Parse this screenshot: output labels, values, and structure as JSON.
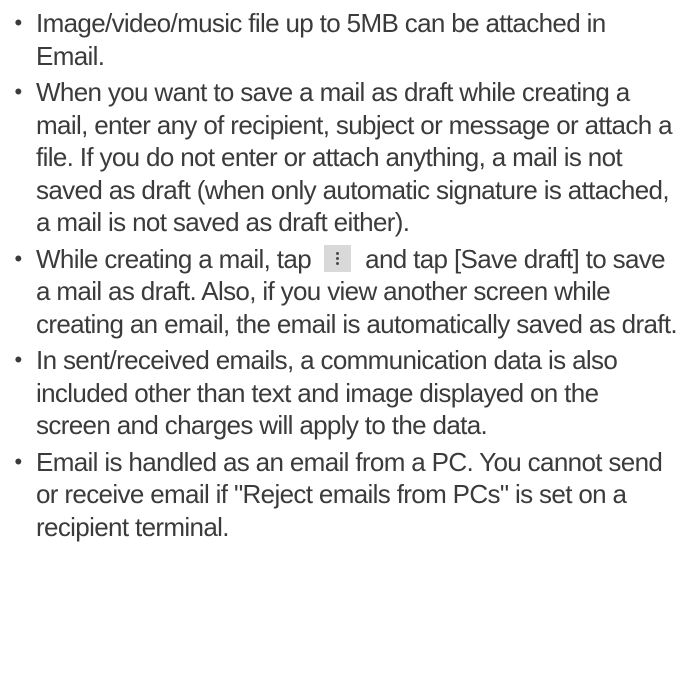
{
  "bullet_char": "•",
  "notes": [
    "Image/video/music file up to 5MB can be attached in Email.",
    "When you want to save a mail as draft while creating a mail, enter any of recipient, subject or message or attach a file. If you do not enter or attach anything, a mail is not saved as draft (when only automatic signature is attached, a mail is not saved as draft either).",
    {
      "before_icon": "While creating a mail, tap",
      "icon": "menu-overflow-icon",
      "after_icon": "and tap [Save draft] to save a mail as draft. Also, if you view another screen while creating an email, the email is automatically saved as draft."
    },
    "In sent/received emails, a communication data is also included other than text and image displayed on the screen and charges will apply to the data.",
    "Email is handled as an email from a PC. You cannot send or receive email if \"Reject emails from PCs\" is set on a recipient terminal."
  ],
  "colors": {
    "text": "#3b3b3b",
    "icon_background": "#d9d9d9"
  }
}
